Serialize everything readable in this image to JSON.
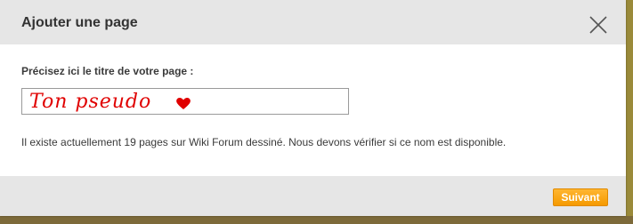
{
  "dialog": {
    "title": "Ajouter une page",
    "close_icon": "close-icon"
  },
  "form": {
    "prompt_label": "Précisez ici le titre de votre page :",
    "title_value": "Ton pseudo",
    "heart_icon": "heart-icon",
    "info_text": "Il existe actuellement 19 pages sur Wiki Forum dessiné. Nous devons vérifier si ce nom est disponible."
  },
  "footer": {
    "next_label": "Suivant"
  },
  "colors": {
    "header_bg": "#e6e6e6",
    "accent": "#f59a00",
    "handwriting": "#e00000"
  }
}
